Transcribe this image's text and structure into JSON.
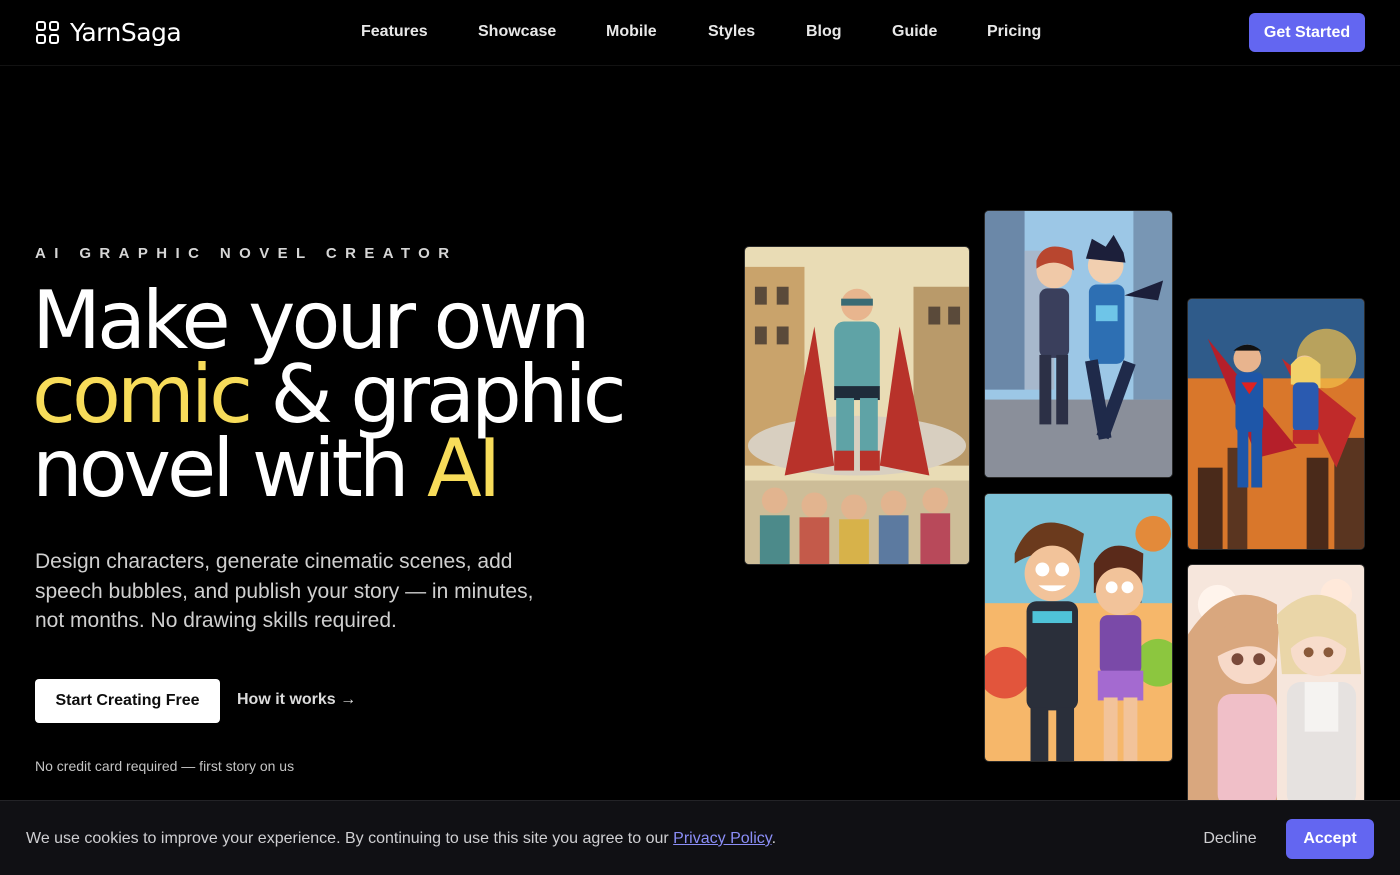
{
  "brand": {
    "name": "YarnSaga",
    "logo_icon": "grid-logo-icon"
  },
  "nav": {
    "links": [
      "Features",
      "Showcase",
      "Mobile",
      "Styles",
      "Blog",
      "Guide",
      "Pricing"
    ],
    "cta": "Get Started"
  },
  "hero": {
    "eyebrow": "AI GRAPHIC NOVEL CREATOR",
    "headline": {
      "line1": "Make your own",
      "line2_highlight": "comic",
      "line2_rest": " & graphic",
      "line3_rest": "novel with ",
      "line3_highlight": "AI"
    },
    "subtitle": "Design characters, generate cinematic scenes, add speech bubbles, and publish your story — in minutes, not months. No drawing skills required.",
    "primary_cta": "Start Creating Free",
    "secondary_cta": "How it works →",
    "fine_print": "No credit card required — first story on us"
  },
  "gallery": {
    "images": [
      "retro-superhero-comic-image",
      "anime-heroes-city-image",
      "superhero-duo-flying-image",
      "cartoon-couple-image",
      "anime-couple-image"
    ]
  },
  "cookie": {
    "text": "We use cookies to improve your experience. By continuing to use this site you agree to our ",
    "link": "Privacy Policy",
    "suffix": ".",
    "decline": "Decline",
    "accept": "Accept"
  },
  "colors": {
    "accent": "#6366f1",
    "highlight": "#f7dc5a",
    "background": "#000000",
    "cookie_bar": "#101014"
  }
}
